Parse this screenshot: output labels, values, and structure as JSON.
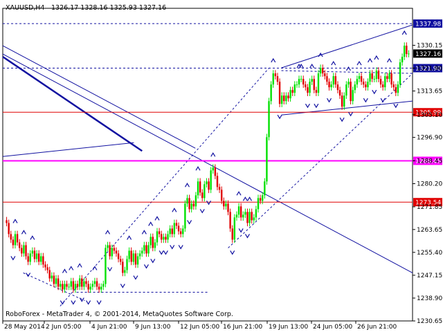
{
  "header": {
    "symbol": "XAUUSD,H4",
    "ohlc": "1326.17 1328.16 1325.93 1327.16"
  },
  "footer": {
    "copyright": "RoboForex - MetaTrader 4, © 2001-2014, MetaQuotes Software Corp."
  },
  "colors": {
    "up_candle": "#00e000",
    "down_candle": "#e00000",
    "trend": "#1010a0",
    "level_line": "#e00000",
    "key_level": "#ff00ff",
    "key_level_label_bg": "#ff00ff",
    "level_label_bg": "#e00000",
    "price_label_bg": "#000000",
    "grid": "#000000"
  },
  "chart_data": {
    "type": "candlestick",
    "title": "",
    "ylim": [
      1230.65,
      1343.5
    ],
    "price_axis_ticks": [
      1330.15,
      1321.9,
      1313.65,
      1305.1,
      1296.9,
      1288.45,
      1280.2,
      1271.85,
      1263.65,
      1255.4,
      1247.15,
      1238.9,
      1230.65
    ],
    "time_axis_labels": [
      "28 May 2014",
      "2 Jun 05:00",
      "4 Jun 21:00",
      "9 Jun 13:00",
      "12 Jun 05:00",
      "16 Jun 21:00",
      "19 Jun 13:00",
      "24 Jun 05:00",
      "26 Jun 21:00"
    ],
    "current_price": 1327.16,
    "horizontal_levels": [
      {
        "price": 1337.98,
        "style": "dashed",
        "label": "1337.98"
      },
      {
        "price": 1321.9,
        "style": "dashed",
        "label": "1321.90"
      },
      {
        "price": 1305.99,
        "style": "solid",
        "label": "1305.99"
      },
      {
        "price": 1288.45,
        "style": "solid-thick",
        "label": "1288.45"
      },
      {
        "price": 1273.54,
        "style": "solid",
        "label": "1273.54"
      }
    ],
    "closes": [
      1266,
      1262,
      1260,
      1258,
      1262,
      1259,
      1257,
      1255,
      1258,
      1254,
      1252,
      1255,
      1256,
      1253,
      1255,
      1252,
      1254,
      1251,
      1250,
      1249,
      1246,
      1247,
      1244,
      1246,
      1243,
      1244,
      1242,
      1244,
      1243,
      1243,
      1245,
      1242,
      1244,
      1243,
      1246,
      1243,
      1245,
      1244,
      1242,
      1243,
      1244,
      1245,
      1243,
      1242,
      1243,
      1244,
      1257,
      1258,
      1254,
      1257,
      1256,
      1255,
      1253,
      1252,
      1248,
      1249,
      1253,
      1256,
      1252,
      1255,
      1251,
      1254,
      1255,
      1256,
      1258,
      1255,
      1258,
      1261,
      1257,
      1259,
      1263,
      1262,
      1260,
      1261,
      1260,
      1262,
      1264,
      1262,
      1266,
      1265,
      1263,
      1262,
      1264,
      1273,
      1275,
      1271,
      1273,
      1272,
      1276,
      1281,
      1277,
      1275,
      1280,
      1281,
      1278,
      1285,
      1286,
      1283,
      1279,
      1278,
      1274,
      1272,
      1273,
      1270,
      1264,
      1260,
      1268,
      1269,
      1272,
      1268,
      1269,
      1270,
      1266,
      1270,
      1267,
      1268,
      1271,
      1275,
      1274,
      1276,
      1281,
      1297,
      1310,
      1316,
      1320,
      1319,
      1317,
      1309,
      1312,
      1310,
      1312,
      1311,
      1314,
      1313,
      1316,
      1316,
      1318,
      1318,
      1316,
      1315,
      1313,
      1317,
      1318,
      1314,
      1313,
      1320,
      1322,
      1320,
      1319,
      1317,
      1315,
      1316,
      1319,
      1316,
      1314,
      1312,
      1308,
      1312,
      1316,
      1317,
      1310,
      1314,
      1316,
      1318,
      1319,
      1317,
      1316,
      1315,
      1317,
      1320,
      1318,
      1318,
      1321,
      1318,
      1316,
      1315,
      1319,
      1318,
      1320,
      1316,
      1315,
      1313,
      1316,
      1324,
      1326,
      1330,
      1327,
      1327.16
    ]
  }
}
